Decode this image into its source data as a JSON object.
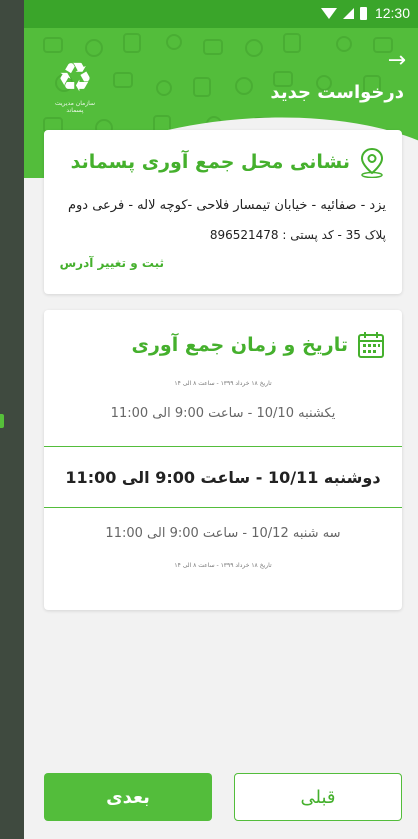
{
  "status_bar": {
    "time": "12:30"
  },
  "header": {
    "title": "درخواست جدید",
    "back_icon": "arrow-right-icon",
    "logo_icon": "recycle-icon",
    "logo_caption": "سازمان مدیریت پسماند"
  },
  "address_card": {
    "title": "نشانی محل جمع آوری پسماند",
    "icon": "location-pin-icon",
    "line1": "یزد - صفائیه - خیابان تیمسار فلاحی -کوچه لاله - فرعی دوم",
    "line2": "پلاک 35 - کد پستی : 896521478",
    "change_label": "ثبت و تغییر آدرس"
  },
  "time_card": {
    "title": "تاریخ و زمان جمع آوری",
    "icon": "calendar-icon",
    "caption_top": "تاریخ ۱۸ خرداد ۱۳۹۹ - ساعت ۸ الی ۱۴",
    "slots": [
      {
        "label": "یکشنبه 10/10 - ساعت 9:00 الی 11:00",
        "selected": false
      },
      {
        "label": "دوشنبه 10/11 - ساعت 9:00 الی 11:00",
        "selected": true
      },
      {
        "label": "سه شنبه 10/12 - ساعت 9:00 الی 11:00",
        "selected": false
      }
    ],
    "caption_bottom": "تاریخ ۱۸ خرداد ۱۳۹۹ - ساعت ۸ الی ۱۴"
  },
  "buttons": {
    "next": "بعدی",
    "prev": "قبلی"
  },
  "colors": {
    "primary": "#53bd3b",
    "primary_dark": "#3aa52a",
    "side_strip": "#3f4a3f"
  }
}
